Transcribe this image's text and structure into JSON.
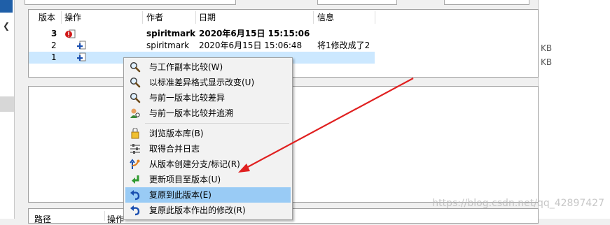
{
  "log": {
    "columns": [
      "版本",
      "操作",
      "作者",
      "日期",
      "信息"
    ],
    "rows": [
      {
        "rev": "3",
        "author": "spiritmark",
        "date": "2020年6月15日 15:15:06",
        "message": "",
        "bold": true
      },
      {
        "rev": "2",
        "author": "spiritmark",
        "date": "2020年6月15日 15:06:48",
        "message": "将1修改成了2",
        "bold": false
      },
      {
        "rev": "1",
        "author": "",
        "date": "",
        "message": "",
        "bold": false
      }
    ]
  },
  "lower": {
    "path_header": "路径",
    "action_header": "操作"
  },
  "right": {
    "kb1": "KB",
    "kb2": "KB"
  },
  "menu": {
    "items": [
      {
        "label": "与工作副本比较(W)",
        "icon": "magnifier-icon"
      },
      {
        "label": "以标准差异格式显示改变(U)",
        "icon": "magnifier-icon"
      },
      {
        "label": "与前一版本比较差异",
        "icon": "magnifier-icon"
      },
      {
        "label": "与前一版本比较并追溯",
        "icon": "user-magnifier-icon"
      },
      {
        "label": "浏览版本库(B)",
        "icon": "repo-browser-icon"
      },
      {
        "label": "取得合并日志",
        "icon": "merge-log-icon"
      },
      {
        "label": "从版本创建分支/标记(R)",
        "icon": "branch-icon"
      },
      {
        "label": "更新项目至版本(U)",
        "icon": "update-icon"
      },
      {
        "label": "复原到此版本(E)",
        "icon": "revert-icon"
      },
      {
        "label": "复原此版本作出的修改(R)",
        "icon": "revert-icon"
      }
    ],
    "highlighted_index": 8
  },
  "watermark": "https://blog.csdn.net/qq_42897427",
  "colors": {
    "selection": "#cce8ff",
    "menu_highlight": "#99cbf5",
    "arrow": "#e02020"
  }
}
